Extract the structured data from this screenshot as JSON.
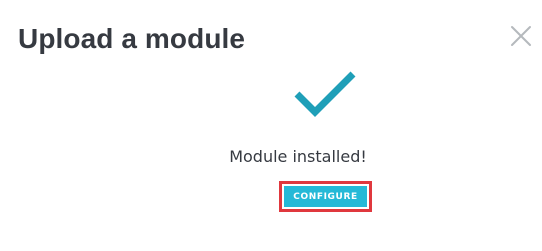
{
  "modal": {
    "title": "Upload a module",
    "close_icon": "close-icon"
  },
  "success": {
    "icon": "checkmark-icon",
    "icon_color": "#1f9fb8",
    "message": "Module installed!"
  },
  "actions": {
    "configure_label": "CONFIGURE",
    "configure_color": "#25b9d7",
    "highlight_color": "#e0383e"
  }
}
